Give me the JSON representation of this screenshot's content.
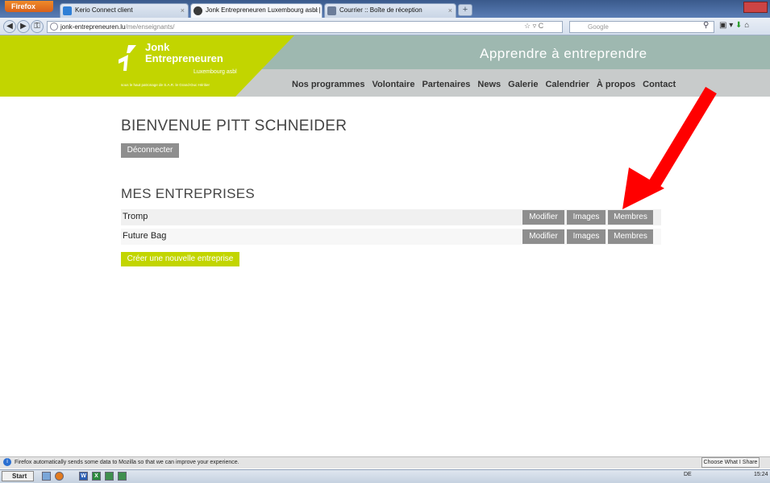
{
  "browser": {
    "app_button": "Firefox",
    "tabs": [
      {
        "label": "Kerio Connect client",
        "color": "#2f7fd6"
      },
      {
        "label": "Jonk Entrepreneuren Luxembourg asbl | ...",
        "color": "#3a3a3a"
      },
      {
        "label": "Courrier :: Boîte de réception",
        "color": "#6b7c99"
      }
    ],
    "url_host": "jonk-entrepreneuren.lu",
    "url_path": "/me/enseignants/",
    "search_placeholder": "Google"
  },
  "site": {
    "logo_line1": "Jonk",
    "logo_line2": "Entrepreneuren",
    "logo_sub": "Luxembourg asbl",
    "logo_tag": "sous le haut patronage de S.A.R. le Grand-Duc Héritier",
    "tagline": "Apprendre à entreprendre",
    "nav": [
      "Nos programmes",
      "Volontaire",
      "Partenaires",
      "News",
      "Galerie",
      "Calendrier",
      "À propos",
      "Contact"
    ],
    "accent": "#c2d500",
    "teal": "#9eb8b0"
  },
  "page": {
    "welcome": "BIENVENUE PITT SCHNEIDER",
    "logout": "Déconnecter",
    "companies_title": "MES ENTREPRISES",
    "companies": [
      {
        "name": "Tromp",
        "edit": "Modifier",
        "images": "Images",
        "members": "Membres"
      },
      {
        "name": "Future Bag",
        "edit": "Modifier",
        "images": "Images",
        "members": "Membres"
      }
    ],
    "create": "Créer une nouvelle entreprise"
  },
  "status": {
    "message": "Firefox automatically sends some data to Mozilla so that we can improve your experience.",
    "choose": "Choose What I Share"
  },
  "taskbar": {
    "start": "Start",
    "lang": "DE",
    "clock": "15:24"
  }
}
